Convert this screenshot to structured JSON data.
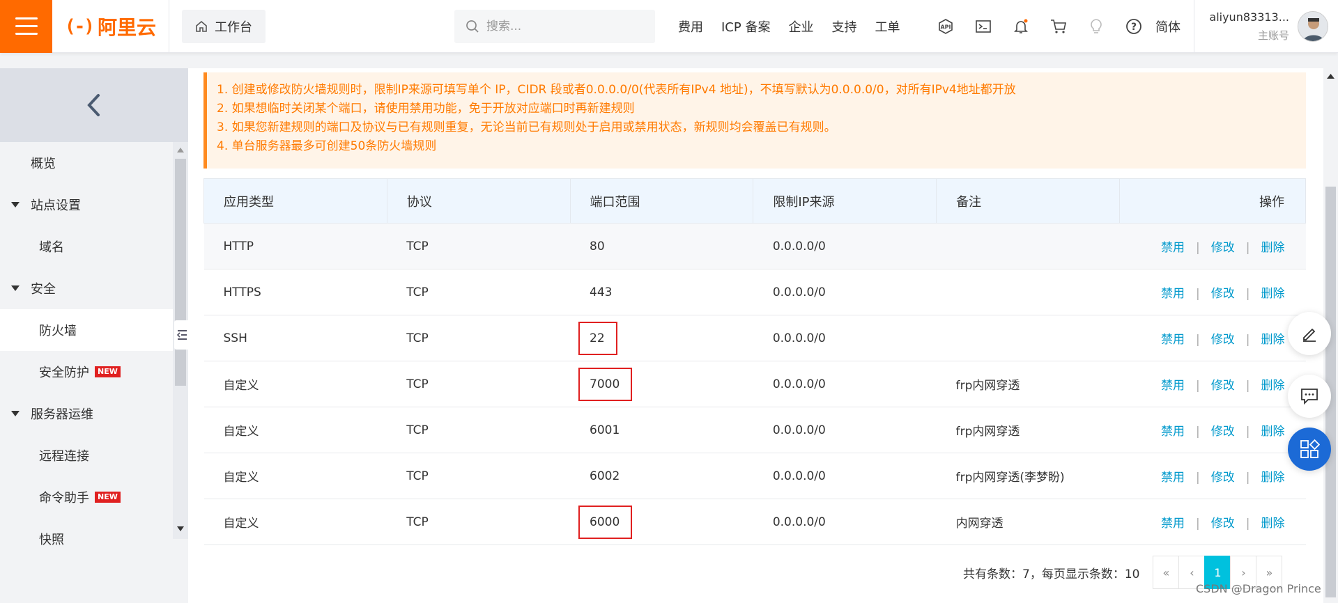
{
  "header": {
    "logo_text": "阿里云",
    "workbench_label": "工作台",
    "search_placeholder": "搜索...",
    "nav": [
      "费用",
      "ICP 备案",
      "企业",
      "支持",
      "工单"
    ],
    "language": "简体",
    "user_name": "aliyun83313...",
    "user_role": "主账号"
  },
  "sidebar": {
    "items": [
      {
        "label": "概览"
      },
      {
        "label": "站点设置"
      },
      {
        "label": "域名"
      },
      {
        "label": "安全"
      },
      {
        "label": "防火墙"
      },
      {
        "label": "安全防护",
        "badge": "NEW"
      },
      {
        "label": "服务器运维"
      },
      {
        "label": "远程连接"
      },
      {
        "label": "命令助手",
        "badge": "NEW"
      },
      {
        "label": "快照"
      }
    ]
  },
  "notice": {
    "lines": [
      "1. 创建或修改防火墙规则时，限制IP来源可填写单个 IP，CIDR 段或者0.0.0.0/0(代表所有IPv4 地址)，不填写默认为0.0.0.0/0，对所有IPv4地址都开放",
      "2. 如果想临时关闭某个端口，请使用禁用功能，免于开放对应端口时再新建规则",
      "3. 如果您新建规则的端口及协议与已有规则重复，无论当前已有规则处于启用或禁用状态，新规则均会覆盖已有规则。",
      "4. 单台服务器最多可创建50条防火墙规则"
    ]
  },
  "table": {
    "headers": [
      "应用类型",
      "协议",
      "端口范围",
      "限制IP来源",
      "备注",
      "操作"
    ],
    "actions": {
      "disable": "禁用",
      "edit": "修改",
      "delete": "删除",
      "sep": "|"
    },
    "rows": [
      {
        "type": "HTTP",
        "protocol": "TCP",
        "port": "80",
        "source": "0.0.0.0/0",
        "remark": ""
      },
      {
        "type": "HTTPS",
        "protocol": "TCP",
        "port": "443",
        "source": "0.0.0.0/0",
        "remark": ""
      },
      {
        "type": "SSH",
        "protocol": "TCP",
        "port": "22",
        "source": "0.0.0.0/0",
        "remark": ""
      },
      {
        "type": "自定义",
        "protocol": "TCP",
        "port": "7000",
        "source": "0.0.0.0/0",
        "remark": "frp内网穿透"
      },
      {
        "type": "自定义",
        "protocol": "TCP",
        "port": "6001",
        "source": "0.0.0.0/0",
        "remark": "frp内网穿透"
      },
      {
        "type": "自定义",
        "protocol": "TCP",
        "port": "6002",
        "source": "0.0.0.0/0",
        "remark": "frp内网穿透(李梦盼)"
      },
      {
        "type": "自定义",
        "protocol": "TCP",
        "port": "6000",
        "source": "0.0.0.0/0",
        "remark": "内网穿透"
      }
    ]
  },
  "pager": {
    "total_text": "共有条数：7，每页显示条数：10",
    "first": "«",
    "prev": "‹",
    "current": "1",
    "next": "›",
    "last": "»"
  },
  "watermark": "CSDN @Dragon Prince",
  "colors": {
    "brand": "#ff6a00",
    "link": "#0099cc",
    "highlight": "#e02020",
    "page_active": "#00c1de"
  }
}
